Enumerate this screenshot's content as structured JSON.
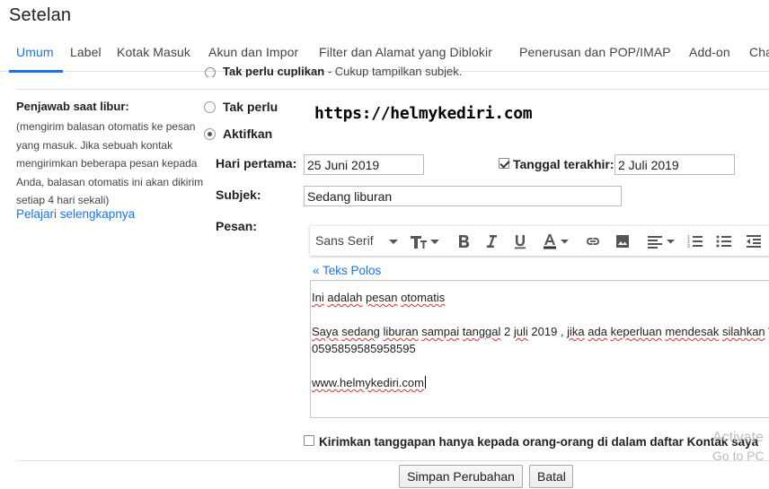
{
  "page": {
    "title": "Setelan"
  },
  "tabs": [
    {
      "label": "Umum",
      "active": true
    },
    {
      "label": "Label"
    },
    {
      "label": "Kotak Masuk"
    },
    {
      "label": "Akun dan Impor"
    },
    {
      "label": "Filter dan Alamat yang Diblokir"
    },
    {
      "label": "Penerusan dan POP/IMAP"
    },
    {
      "label": "Add-on"
    },
    {
      "label": "Cha"
    }
  ],
  "cut_row": {
    "option": "Tak perlu cuplikan",
    "desc": "- Cukup tampilkan subjek."
  },
  "vacation": {
    "title": "Penjawab saat libur:",
    "description": "(mengirim balasan otomatis ke pesan yang masuk. Jika sebuah kontak mengirimkan beberapa pesan kepada Anda, balasan otomatis ini akan dikirim setiap 4 hari sekali)",
    "learn_more": "Pelajari selengkapnya",
    "option_off": "Tak perlu",
    "option_on": "Aktifkan",
    "first_day_label": "Hari pertama:",
    "first_day_value": "25 Juni 2019",
    "last_day_label": "Tanggal terakhir:",
    "last_day_value": "2 Juli 2019",
    "last_day_checked": true,
    "subject_label": "Subjek:",
    "subject_value": "Sedang liburan",
    "message_label": "Pesan:",
    "watermark": "https://helmykediri.com"
  },
  "toolbar": {
    "font": "Sans Serif",
    "icons": [
      "text-size-icon",
      "bold-icon",
      "italic-icon",
      "underline-icon",
      "text-color-icon",
      "link-icon",
      "image-icon",
      "align-icon",
      "numbered-list-icon",
      "bulleted-list-icon",
      "indent-less-icon"
    ]
  },
  "editor": {
    "plain_text_link": "« Teks Polos",
    "line1": [
      "Ini",
      " ",
      "adalah",
      " ",
      "pesan",
      " ",
      "otomatis"
    ],
    "line2": [
      "Saya",
      " ",
      "sedang",
      " ",
      "liburan",
      " ",
      "sampai",
      " ",
      "tanggal",
      " 2 ",
      "juli",
      " 2019 , ",
      "jika",
      " ",
      "ada",
      " ",
      "keperluan",
      " ",
      "mendesak",
      " ",
      "silahkan",
      " W"
    ],
    "line3": "0595859585958595",
    "line4": "www.helmykediri.com"
  },
  "contacts_only": {
    "label": "Kirimkan tanggapan hanya kepada orang-orang di dalam daftar Kontak saya",
    "checked": false
  },
  "windows_activation": {
    "title": "Activate",
    "subtitle": "Go to PC"
  },
  "buttons": {
    "save": "Simpan Perubahan",
    "cancel": "Batal"
  },
  "colors": {
    "accent": "#1a73e8",
    "spellcheck": "#d93025"
  }
}
